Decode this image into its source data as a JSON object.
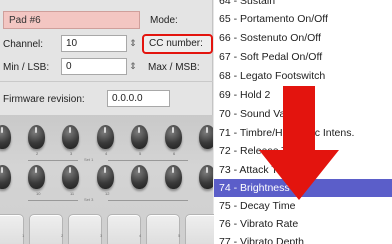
{
  "pad_settings": {
    "pad_name": "Pad #6",
    "mode_label": "Mode:",
    "channel_label": "Channel:",
    "channel_value": "10",
    "cc_number_label": "CC number:",
    "min_lsb_label": "Min / LSB:",
    "min_lsb_value": "0",
    "max_msb_label": "Max / MSB:",
    "firmware_label": "Firmware revision:",
    "firmware_value": "0.0.0.0"
  },
  "photo": {
    "knob_numbers": [
      "1",
      "2",
      "3",
      "4",
      "5",
      "6",
      "7",
      "8",
      "9",
      "10",
      "11",
      "12"
    ],
    "set_labels": [
      "Set 1",
      "Set 3"
    ],
    "pad_numbers": [
      "1",
      "2",
      "3",
      "4",
      "5",
      "6"
    ]
  },
  "cc_dropdown": {
    "options": [
      "64 - Sustain",
      "65 - Portamento On/Off",
      "66 - Sostenuto On/Off",
      "67 - Soft Pedal On/Off",
      "68 - Legato Footswitch",
      "69 - Hold 2",
      "70 - Sound Variation",
      "71 - Timbre/Harmonic Intens.",
      "72 - Release Time",
      "73 - Attack Time",
      "74 - Brightness",
      "75 - Decay Time",
      "76 - Vibrato Rate",
      "77 - Vibrato Depth"
    ],
    "selected": "74 - Brightness"
  },
  "colors": {
    "highlight": "#5b5ec9",
    "annotation_red": "#e3140e",
    "pad_field_bg": "#f3c6c2"
  },
  "icons": {
    "spinner": "up-down-arrows-icon",
    "annotation": "red-down-arrow"
  }
}
